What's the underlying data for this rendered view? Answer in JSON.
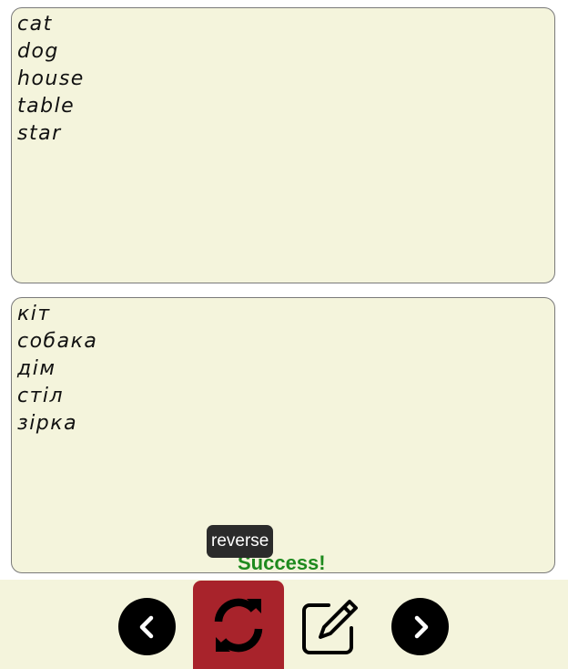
{
  "source_words": [
    "cat",
    "dog",
    "house",
    "table",
    "star"
  ],
  "target_words": [
    "кіт",
    "собака",
    "дім",
    "стіл",
    "зірка"
  ],
  "tooltip": "reverse",
  "status": "Success!",
  "toolbar": {
    "buttons": [
      {
        "name": "prev",
        "icon": "chevron-left-icon"
      },
      {
        "name": "reverse",
        "icon": "sync-icon"
      },
      {
        "name": "edit",
        "icon": "edit-icon"
      },
      {
        "name": "next",
        "icon": "chevron-right-icon"
      }
    ]
  },
  "colors": {
    "panel_bg": "#f4f4dc",
    "reverse_active": "#a8232b",
    "status_text": "#1e8a1e",
    "tooltip_bg": "#2b2b2b"
  }
}
